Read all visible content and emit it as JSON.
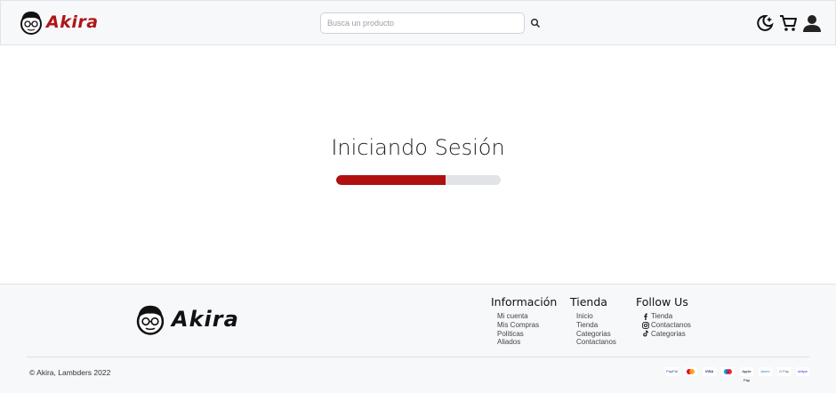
{
  "header": {
    "brand": "Akira",
    "search_placeholder": "Busca un producto",
    "icons": [
      "search-icon",
      "theme-toggle-icon",
      "cart-icon",
      "user-icon"
    ]
  },
  "main": {
    "title": "Iniciando Sesión",
    "progress_fraction": 0.665
  },
  "footer": {
    "brand": "Akira",
    "columns": [
      {
        "title": "Información",
        "items": [
          "Mi cuenta",
          "Mis Compras",
          "Politicas",
          "Aliados"
        ]
      },
      {
        "title": "Tienda",
        "items": [
          "Inicio",
          "Tienda",
          "Categorias",
          "Contactanos"
        ]
      },
      {
        "title": "Follow Us",
        "items": [
          "Tienda",
          "Contactanos",
          "Categorias"
        ]
      }
    ],
    "social_icons": [
      "facebook-icon",
      "instagram-icon",
      "tiktok-icon"
    ],
    "copyright": "© Akira, Lambders 2022",
    "payment_methods": [
      "PayPal",
      "Mastercard",
      "VISA",
      "Maestro",
      "Apple Pay",
      "Amex",
      "G Pay",
      "stripe"
    ]
  },
  "colors": {
    "accent": "#b01010",
    "header_bg": "#f7f8fa",
    "progress_track": "#e1e3e7"
  }
}
